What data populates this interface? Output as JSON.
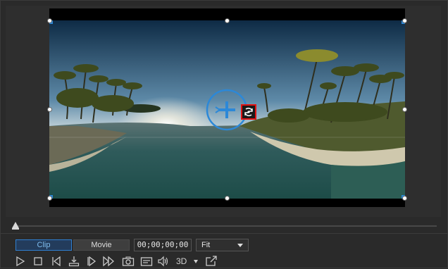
{
  "tabs": {
    "clip": "Clip",
    "movie": "Movie"
  },
  "timecode": "00;00;00;00",
  "fit": {
    "value": "Fit"
  },
  "three_d": {
    "label": "3D"
  },
  "colors": {
    "accent": "#2c88d8",
    "rotate_highlight": "#e31212",
    "panel_bg": "#2a2a2a",
    "clip_tab_bg": "#233c5c"
  },
  "icons": {
    "playback": [
      "play-icon",
      "stop-icon",
      "previous-frame-icon",
      "split-icon",
      "next-frame-icon",
      "fast-forward-icon",
      "snapshot-icon",
      "subtitle-icon",
      "volume-icon",
      "3d-icon",
      "external-display-icon"
    ],
    "overlay": [
      "center-move-icon",
      "rotate-360-icon"
    ]
  }
}
